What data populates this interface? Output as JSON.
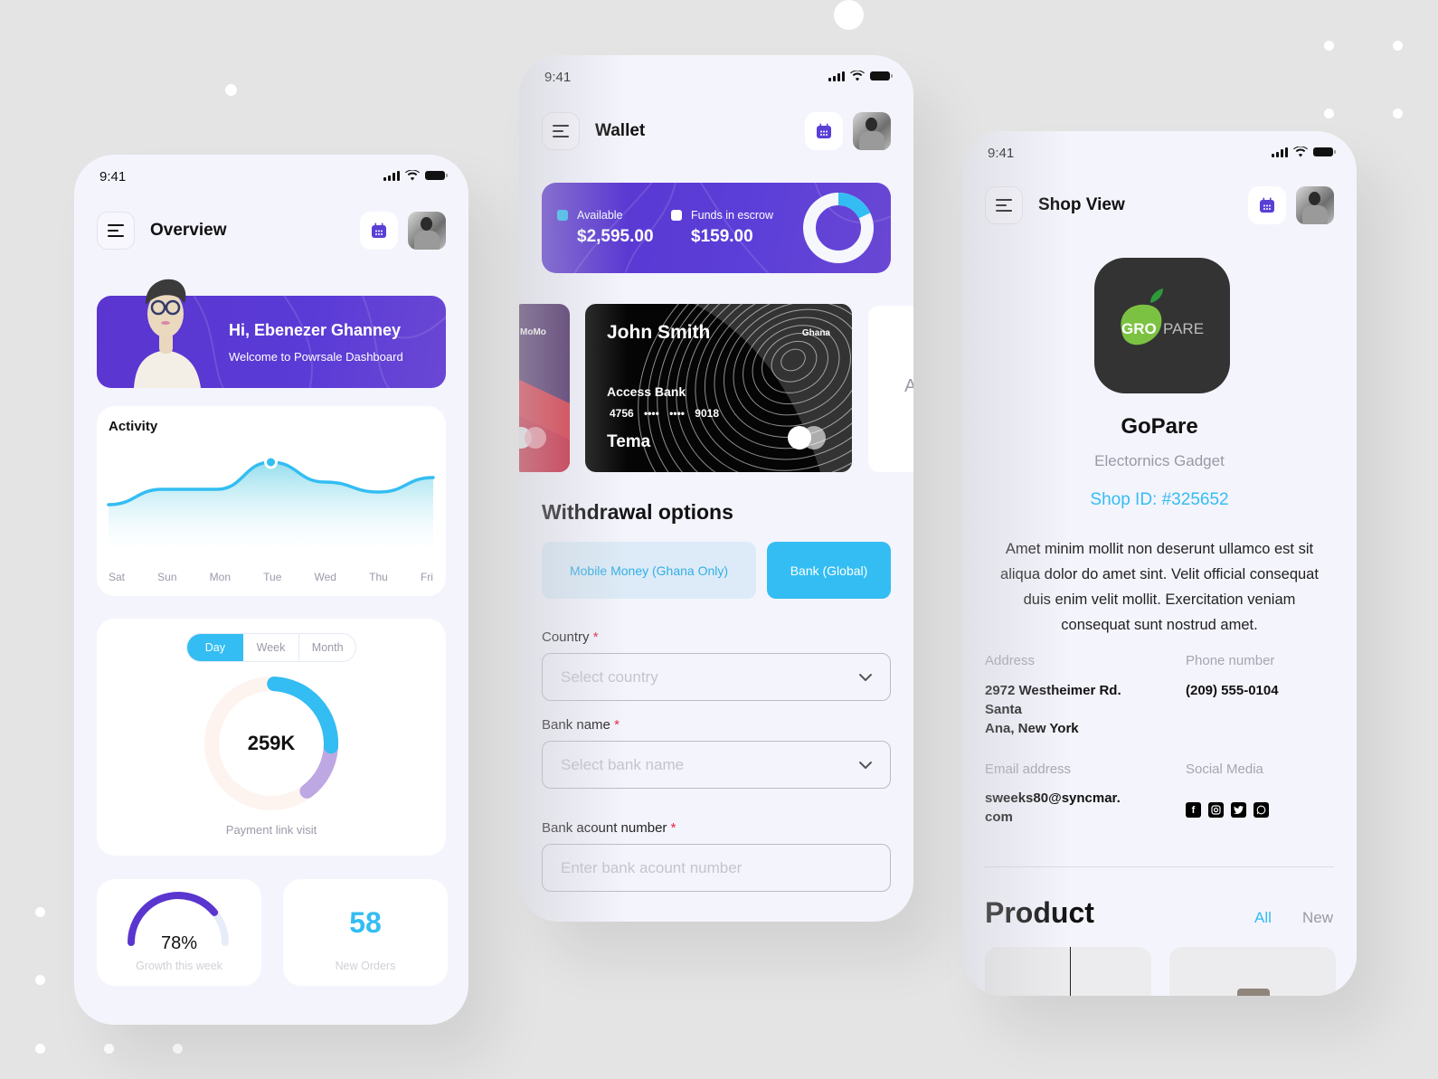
{
  "colors": {
    "accent_blue": "#33bdf2",
    "brand_purple": "#5a35cf",
    "background": "#e4e4e4",
    "phone_bg": "#f4f4fd",
    "required": "#e5243f"
  },
  "overview": {
    "status_time": "9:41",
    "title": "Overview",
    "menu_icon": "hamburger-menu-icon",
    "calendar_icon": "calendar-icon",
    "welcome": {
      "greeting": "Hi, Ebenezer Ghanney",
      "subtitle": "Welcome to Powrsale Dashboard"
    },
    "activity": {
      "title": "Activity"
    },
    "visits": {
      "tabs": [
        "Day",
        "Week",
        "Month"
      ],
      "active_tab": "Day",
      "value": "259K",
      "label": "Payment link visit",
      "segments": [
        {
          "name": "blue",
          "fraction": 0.25,
          "color": "#33bdf2"
        },
        {
          "name": "purple",
          "fraction": 0.14,
          "color": "#bda8e3"
        }
      ]
    },
    "growth": {
      "value": "78%",
      "fraction": 0.78,
      "label": "Growth this week"
    },
    "orders": {
      "value": "58",
      "label": "New Orders"
    }
  },
  "chart_data": {
    "type": "area",
    "title": "Activity",
    "categories": [
      "Sat",
      "Sun",
      "Mon",
      "Tue",
      "Wed",
      "Thu",
      "Fri"
    ],
    "values": [
      43,
      60,
      60,
      90,
      68,
      57,
      73
    ],
    "highlight_index": 3,
    "xlabel": "",
    "ylabel": "",
    "ylim": [
      0,
      100
    ],
    "grid": false
  },
  "wallet": {
    "status_time": "9:41",
    "title": "Wallet",
    "balance": {
      "available_label": "Available",
      "available_amount": "$2,595.00",
      "escrow_label": "Funds in escrow",
      "escrow_amount": "$159.00",
      "available_color": "#33bdf2",
      "escrow_color": "#ffffff",
      "ring_fraction": 0.18
    },
    "cards": {
      "prev_card_label": "MoMo",
      "main_card": {
        "holder": "John Smith",
        "country": "Ghana",
        "bank": "Access Bank",
        "number": "4756 •••• •••• 9018",
        "city": "Tema"
      },
      "next_card_partial": "A"
    },
    "withdrawal": {
      "title": "Withdrawal options",
      "options": [
        "Mobile Money (Ghana Only)",
        "Bank (Global)"
      ],
      "selected": "Bank (Global)"
    },
    "form": {
      "country_label": "Country",
      "country_placeholder": "Select country",
      "bank_label": "Bank name",
      "bank_placeholder": "Select bank name",
      "account_label": "Bank acount number",
      "account_placeholder": "Enter bank acount number",
      "required_mark": "*"
    }
  },
  "shop": {
    "status_time": "9:41",
    "title": "Shop View",
    "logo": {
      "text_left": "GRO",
      "text_right": "PARE"
    },
    "name": "GoPare",
    "category": "Electornics Gadget",
    "shop_id": "Shop ID: #325652",
    "description": "Amet minim mollit non deserunt ullamco est sit aliqua dolor do amet sint. Velit official consequat duis enim velit mollit. Exercitation veniam consequat sunt nostrud amet.",
    "address_label": "Address",
    "address_lines": [
      "2972 Westheimer Rd.",
      "Santa",
      "Ana, New York"
    ],
    "phone_label": "Phone number",
    "phone": "(209) 555-0104",
    "email_label": "Email address",
    "email_lines": [
      "sweeks80@syncmar.",
      "com"
    ],
    "social_label": "Social Media",
    "social_icons": [
      "facebook-icon",
      "instagram-icon",
      "twitter-icon",
      "whatsapp-icon"
    ],
    "products_title": "Product",
    "product_tabs": [
      "All",
      "New"
    ],
    "active_product_tab": "All"
  }
}
